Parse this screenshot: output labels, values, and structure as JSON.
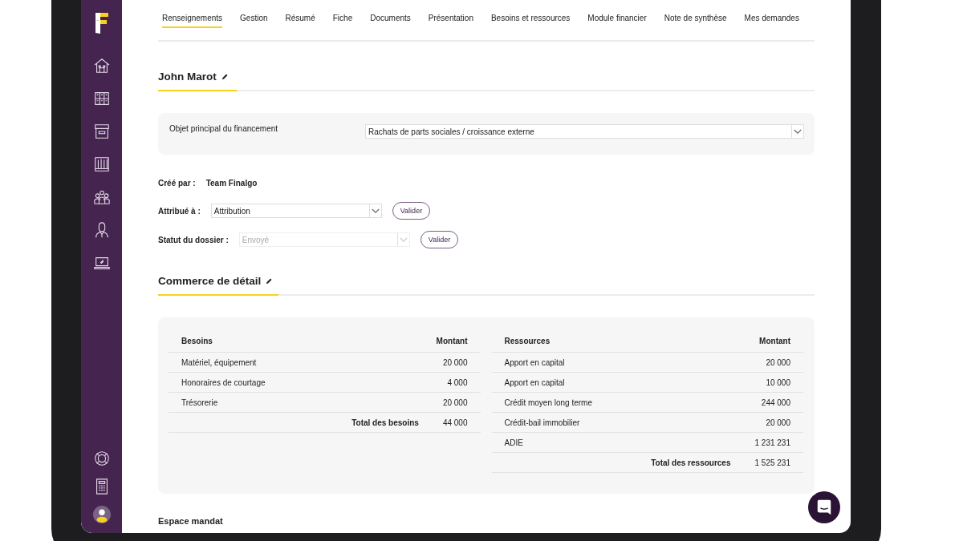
{
  "tabs": [
    {
      "label": "Renseignements",
      "selected": true
    },
    {
      "label": "Gestion",
      "selected": false
    },
    {
      "label": "Résumé",
      "selected": false
    },
    {
      "label": "Fiche",
      "selected": false
    },
    {
      "label": "Documents",
      "selected": false
    },
    {
      "label": "Présentation",
      "selected": false
    },
    {
      "label": "Besoins et ressources",
      "selected": false
    },
    {
      "label": "Module financier",
      "selected": false
    },
    {
      "label": "Note de synthèse",
      "selected": false
    },
    {
      "label": "Mes demandes",
      "selected": false
    }
  ],
  "client": {
    "title": "John Marot",
    "financing": {
      "label": "Objet principal du financement",
      "value": "Rachats de parts sociales / croissance externe"
    }
  },
  "created_by": {
    "label": "Créé par :",
    "value": "Team Finalgo"
  },
  "fields": [
    {
      "label": "Attribué à :",
      "value": "Attribution",
      "disabled": false,
      "button": "Valider"
    },
    {
      "label": "Statut du dossier :",
      "value": "Envoyé",
      "disabled": true,
      "button": "Valider"
    }
  ],
  "activity": {
    "title": "Commerce de détail"
  },
  "tables": [
    {
      "columns": [
        "Besoins",
        "Montant"
      ],
      "rows": [
        {
          "label": "Matériel, équipement",
          "amount": "20 000"
        },
        {
          "label": "Honoraires de courtage",
          "amount": "4 000"
        },
        {
          "label": "Trésorerie",
          "amount": "20 000"
        }
      ],
      "total": {
        "label": "Total des besoins",
        "amount": "44 000"
      }
    },
    {
      "columns": [
        "Ressources",
        "Montant"
      ],
      "rows": [
        {
          "label": "Apport en capital",
          "amount": "20 000"
        },
        {
          "label": "Apport en capital",
          "amount": "10 000"
        },
        {
          "label": "Crédit moyen long terme",
          "amount": "244 000"
        },
        {
          "label": "Crédit-bail immobilier",
          "amount": "20 000"
        },
        {
          "label": "ADIE",
          "amount": "1 231 231"
        }
      ],
      "total": {
        "label": "Total des ressources",
        "amount": "1 525 231"
      }
    }
  ],
  "mandate": {
    "title": "Espace mandat"
  }
}
